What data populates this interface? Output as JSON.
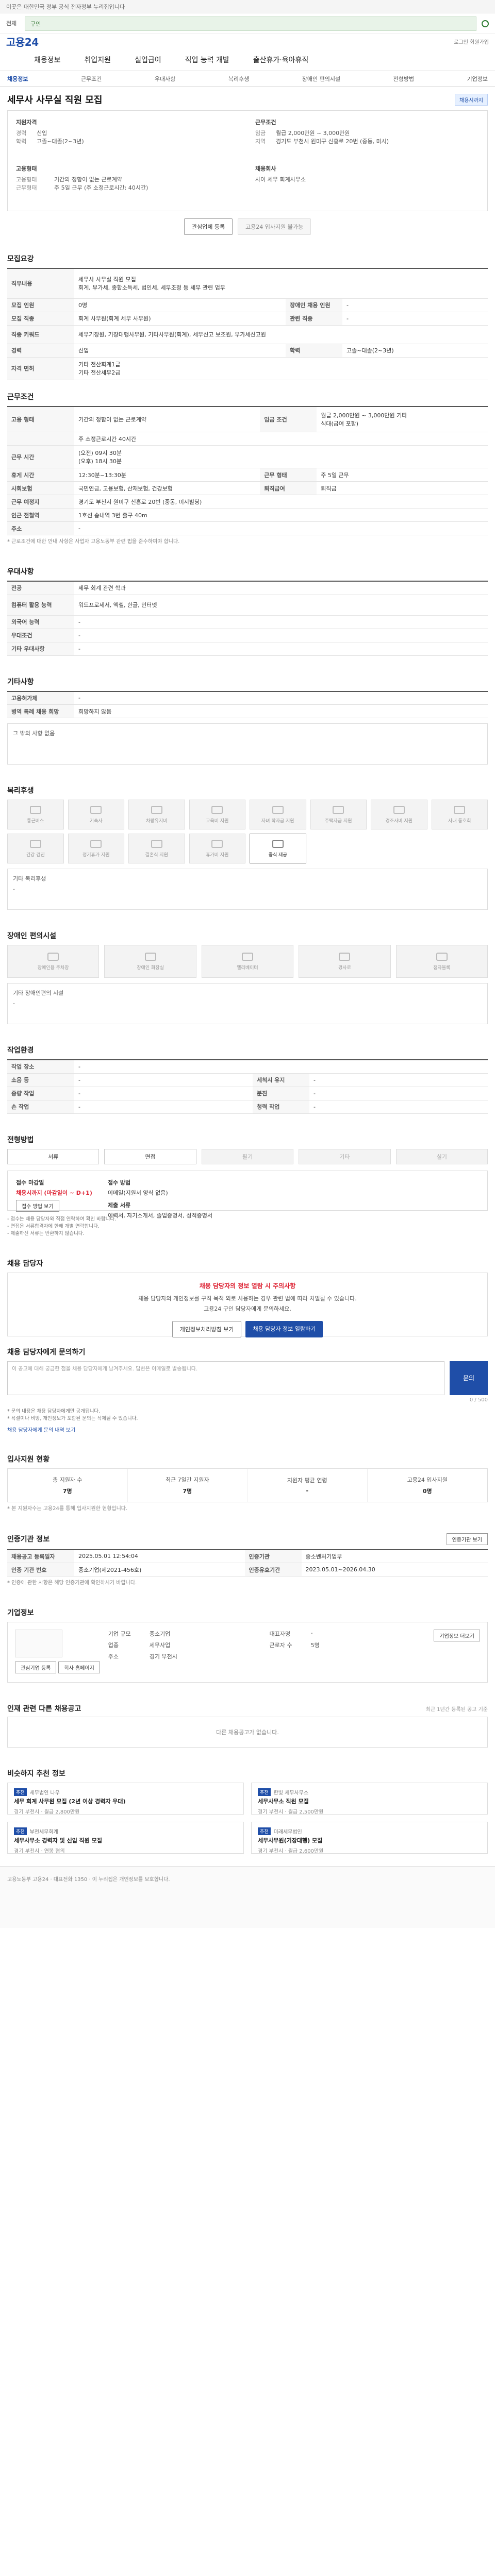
{
  "topbar": {
    "notice": "이곳은 대한민국 정부 공식 전자정부 누리집입니다"
  },
  "search": {
    "selector": "전체",
    "value": "구인",
    "icon": "search-icon"
  },
  "brand": {
    "logo": "고용24",
    "tools": "로그인 회원가입"
  },
  "gnb": [
    "채용정보",
    "취업지원",
    "실업급여",
    "직업 능력 개발",
    "출산휴가·육아휴직"
  ],
  "subtabs": [
    "채용정보",
    "근무조건",
    "우대사항",
    "복리후생",
    "장애인 편의시설",
    "전형방법",
    "기업정보"
  ],
  "job": {
    "title": "세무사 사무실 직원 모집",
    "badge": "채용시까지",
    "summary": {
      "qual_title": "지원자격",
      "qual": [
        [
          "경력",
          "신입"
        ],
        [
          "학력",
          "고졸~대졸(2~3년)"
        ]
      ],
      "cond_title": "근무조건",
      "cond": [
        [
          "임금",
          "월급 2,000만원 ~ 3,000만원"
        ],
        [
          "지역",
          "경기도 부천시 원미구 신흥로 20번 (중동, 미시)"
        ]
      ],
      "type_title": "고용형태",
      "type": [
        [
          "고용형태",
          "기간의 정함이 없는 근로계약"
        ],
        [
          "근무형태",
          "주 5일 근무 (주 소정근로시간: 40시간)"
        ]
      ],
      "company_title": "채용회사",
      "company": [
        [
          "",
          "사이 세무 회계사무소"
        ]
      ]
    }
  },
  "actions": {
    "apply": "관심업체 등록",
    "scrap": "고용24 입사지원 불가능"
  },
  "sections": {
    "recruit": "모집요강",
    "work": "근무조건",
    "pref": "우대사항",
    "other": "기타사항",
    "benefit": "복리후생",
    "disab": "장애인 편의시설",
    "workenv": "작업환경",
    "method": "전형방법",
    "contact": "채용 담당자",
    "inquiry": "채용 담당자에게 문의하기",
    "stats": "입사지원 현황",
    "agency": "인증기관 정보",
    "company": "기업정보",
    "others": "인재 관련 다른 채용공고",
    "recommend": "비슷하지 추천 정보"
  },
  "recruit_table": [
    [
      "직무내용",
      "세무사 사무실 직원 모집\n회계, 부가세, 종합소득세, 법인세, 세무조정 등 세무 관련 업무"
    ],
    [
      "모집 인원",
      "0명",
      "장애인 채용 인원",
      "-"
    ],
    [
      "모집 직종",
      "회계 사무원(회계 세무 사무원)",
      "관련 직종",
      "-"
    ],
    [
      "직종 키워드",
      "세무기장원, 기장대행사무원, 기타사무원(회계), 세무신고 보조원, 부가세신고원"
    ],
    [
      "경력",
      "신입",
      "학력",
      "고졸~대졸(2~3년)"
    ],
    [
      "자격 면허",
      "기타 전산회계1급\n기타 전산세무2급"
    ]
  ],
  "work_table": [
    [
      "고용 형태",
      "기간의 정함이 없는 근로계약",
      "임금 조건",
      "월급 2,000만원 ~ 3,000만원 기타\n식대(급여 포함)"
    ],
    [
      "",
      "주 소정근로시간 40시간"
    ],
    [
      "근무 시간",
      "(오전) 09시 30분\n(오후) 18시 30분"
    ],
    [
      "휴게 시간",
      "12:30분~13:30분",
      "근무 형태",
      "주 5일 근무"
    ],
    [
      "사회보험",
      "국민연금, 고용보험, 산재보험, 건강보험",
      "퇴직급여",
      "퇴직금"
    ],
    [
      "근무 예정지",
      "경기도 부천시 원미구 신흥로 20번 (중동, 미시빌딩)"
    ],
    [
      "인근 전철역",
      "1호선 송내역 3번 출구 40m"
    ],
    [
      "주소",
      "-"
    ]
  ],
  "work_note": "* 근로조건에 대한 안내 사항은 사업자 고용노동부 관련 법을 준수하여야 합니다.",
  "pref_table": [
    [
      "전공",
      "세무 회계 관련 학과"
    ],
    [
      "컴퓨터 활용 능력",
      "워드프로세서, 엑셀, 한글, 인터넷"
    ],
    [
      "외국어 능력",
      "-"
    ],
    [
      "우대조건",
      "-"
    ],
    [
      "기타 우대사항",
      "-"
    ]
  ],
  "other_table": [
    [
      "고용허가제",
      "-"
    ],
    [
      "병역 특례 채용 희망",
      "희망하지 않음"
    ]
  ],
  "other_note": "그 밖의 사항 없음",
  "benefits": [
    "통근버스",
    "기숙사",
    "차량유지비",
    "교육비 지원",
    "자녀 학자금 지원",
    "주택자금 지원",
    "경조사비 지원",
    "사내 동호회",
    "건강 검진",
    "정기휴가 지원",
    "결혼식 지원",
    "휴가비 지원",
    "중식 제공"
  ],
  "benefit_other": {
    "k": "기타 복리후생",
    "v": "-"
  },
  "disab": [
    "장애인용 주차장",
    "장애인 화장실",
    "엘리베이터",
    "경사로",
    "점자블록"
  ],
  "disab_other": {
    "k": "기타 장애인편의 시설",
    "v": "-"
  },
  "workenv_table": [
    [
      "작업 장소",
      "-"
    ],
    [
      "소음 등",
      "-",
      "세척시 유지",
      "-"
    ],
    [
      "중량 작업",
      "-",
      "분진",
      "-"
    ],
    [
      "손 작업",
      "-",
      "청력 작업",
      "-"
    ]
  ],
  "methods": [
    [
      "서류",
      true
    ],
    [
      "면접",
      true
    ],
    [
      "필기",
      false
    ],
    [
      "기타",
      false
    ],
    [
      "실기",
      false
    ]
  ],
  "deadline": {
    "h1": "접수 마감일",
    "v1": "채용시까지 (마감일이 ~ D+1)",
    "btn": "접수 방법 보기",
    "h2": "접수 방법",
    "v2": "이메일(지원서 양식 없음)",
    "h3": "제출 서류",
    "v3": "이력서, 자기소개서, 졸업증명서, 성적증명서"
  },
  "bullets": [
    "- 접수는 채용 담당자와 직접 연락하여 확인 바랍니다.",
    "- 면접은 서류합격자에 한해 개별 연락합니다.",
    "- 제출하신 서류는 반환하지 않습니다."
  ],
  "contact": {
    "warn": "채용 담당자의 정보 열람 시 주의사항",
    "text": "채용 담당자의 개인정보를 구직 목적 외로 사용하는 경우 관련 법에 따라 처벌될 수 있습니다.",
    "sub": "고용24 구인 담당자에게 문의하세요.",
    "b1": "개인정보처리방침 보기",
    "b2": "채용 담당자 정보 열람하기"
  },
  "inquiry": {
    "placeholder": "이 공고에 대해 궁금한 점을 채용 담당자에게 남겨주세요. 답변은 이메일로 발송됩니다.",
    "submit": "문의",
    "count": "0 / 500",
    "notes": [
      "* 문의 내용은 채용 담당자에게만 공개됩니다.",
      "* 욕설이나 비방, 개인정보가 포함된 문의는 삭제될 수 있습니다."
    ],
    "link": "채용 담당자에게 문의 내역 보기"
  },
  "stats": [
    [
      "총 지원자 수",
      "7명"
    ],
    [
      "최근 7일간 지원자",
      "7명"
    ],
    [
      "지원자 평균 연령",
      "-"
    ],
    [
      "고용24 입사지원",
      "0명"
    ]
  ],
  "stats_note": "* 본 지원자수는 고용24를 통해 입사지원한 현황입니다.",
  "agency_btn": "인증기관 보기",
  "agency_table": [
    [
      "채용공고 등록일자",
      "2025.05.01 12:54:04",
      "인증기관",
      "중소벤처기업부"
    ],
    [
      "인증 기관 번호",
      "중소기업(제2021-456호)",
      "인증유효기간",
      "2023.05.01~2026.04.30"
    ]
  ],
  "agency_note": "* 인증에 관한 사항은 해당 인증기관에 확인하시기 바랍니다.",
  "company": {
    "name": "사이 세무 회계사무소",
    "b1": "관심기업 등록",
    "b2": "회사 홈페이지",
    "rows": [
      [
        "기업 규모",
        "중소기업",
        "대표자명",
        "-"
      ],
      [
        "업종",
        "세무사업",
        "근로자 수",
        "5명"
      ],
      [
        "주소",
        "경기 부천시",
        "",
        ""
      ]
    ],
    "right_label": "기업정보 더보기"
  },
  "others_empty": "다른 채용공고가 없습니다.",
  "others_sub": "최근 1년간 등록된 공고 기준",
  "recommend": [
    {
      "tag": "추천",
      "co": "세무법인 나우",
      "title": "세무 회계 사무원 모집 (2년 이상 경력자 우대)",
      "meta": "경기 부천시 · 월급 2,800만원"
    },
    {
      "tag": "추천",
      "co": "한빛 세무사무소",
      "title": "세무사무소 직원 모집",
      "meta": "경기 부천시 · 월급 2,500만원"
    },
    {
      "tag": "추천",
      "co": "부천세무회계",
      "title": "세무사무소 경력자 및 신입 직원 모집",
      "meta": "경기 부천시 · 연봉 협의"
    },
    {
      "tag": "추천",
      "co": "미래세무법인",
      "title": "세무사무원(기장대행) 모집",
      "meta": "경기 부천시 · 월급 2,600만원"
    }
  ],
  "footer": "고용노동부 고용24 · 대표전화 1350 · 이 누리집은 개인정보를 보호합니다."
}
